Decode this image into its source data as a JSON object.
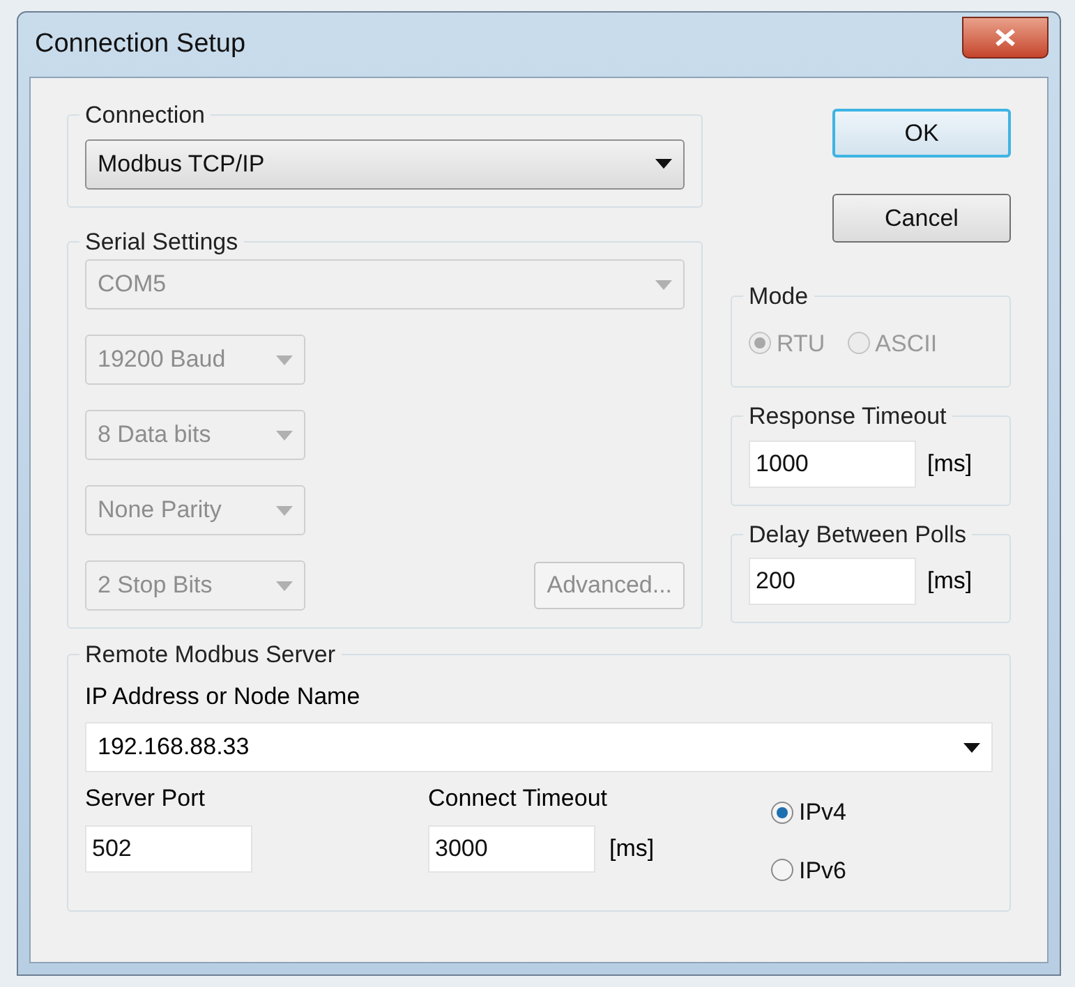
{
  "window": {
    "title": "Connection Setup"
  },
  "connection": {
    "label": "Connection",
    "value": "Modbus TCP/IP"
  },
  "serial_settings": {
    "label": "Serial Settings",
    "disabled": true,
    "port": "COM5",
    "baud": "19200 Baud",
    "data_bits": "8 Data bits",
    "parity": "None Parity",
    "stop_bits": "2 Stop Bits",
    "advanced_button": "Advanced..."
  },
  "buttons": {
    "ok": "OK",
    "cancel": "Cancel"
  },
  "mode": {
    "label": "Mode",
    "disabled": true,
    "options": [
      {
        "label": "RTU",
        "selected": true
      },
      {
        "label": "ASCII",
        "selected": false
      }
    ]
  },
  "response_timeout": {
    "label": "Response Timeout",
    "value": "1000",
    "unit": "[ms]"
  },
  "delay_between_polls": {
    "label": "Delay Between Polls",
    "value": "200",
    "unit": "[ms]"
  },
  "remote_server": {
    "label": "Remote Modbus Server",
    "address_label": "IP Address or Node Name",
    "address_value": "192.168.88.33",
    "port_label": "Server Port",
    "port_value": "502",
    "connect_timeout_label": "Connect Timeout",
    "connect_timeout_value": "3000",
    "connect_timeout_unit": "[ms]",
    "ip_versions": [
      {
        "label": "IPv4",
        "selected": true
      },
      {
        "label": "IPv6",
        "selected": false
      }
    ]
  }
}
